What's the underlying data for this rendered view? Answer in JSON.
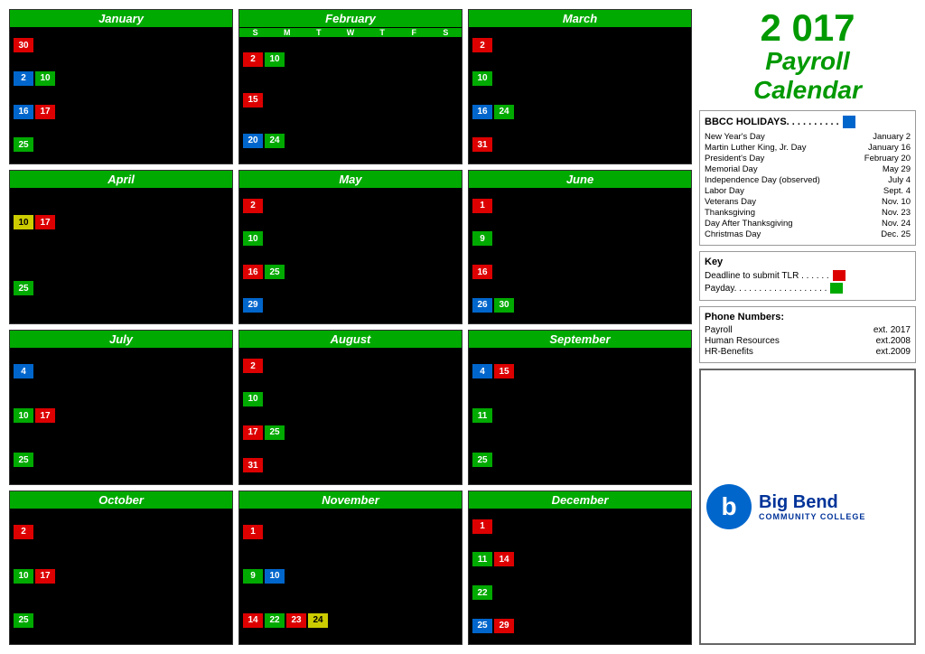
{
  "title": {
    "year": "2 017",
    "line1": "Payroll",
    "line2": "Calendar"
  },
  "months": [
    {
      "name": "January",
      "has_dow": false,
      "rows": [
        [
          {
            "num": "30",
            "color": "red",
            "col": "right"
          }
        ],
        [
          {
            "num": "2",
            "color": "blue",
            "col": "left"
          },
          {
            "num": "10",
            "color": "green",
            "col": "mid"
          }
        ],
        [
          {
            "num": "16",
            "color": "blue",
            "col": "left"
          },
          {
            "num": "17",
            "color": "red",
            "col": "mid"
          }
        ],
        [
          {
            "num": "25",
            "color": "green",
            "col": "mid"
          }
        ]
      ]
    },
    {
      "name": "February",
      "has_dow": true,
      "dow": [
        "S",
        "M",
        "T",
        "W",
        "T",
        "F",
        "S"
      ],
      "rows": [
        [
          {
            "num": "2",
            "color": "red",
            "col": "right"
          },
          {
            "num": "10",
            "color": "green",
            "col": "far-right"
          }
        ],
        [
          {
            "num": "15",
            "color": "red",
            "col": "mid"
          }
        ],
        [
          {
            "num": "20",
            "color": "blue",
            "col": "left"
          },
          {
            "num": "24",
            "color": "green",
            "col": "mid"
          }
        ]
      ]
    },
    {
      "name": "March",
      "has_dow": false,
      "rows": [
        [
          {
            "num": "2",
            "color": "red",
            "col": "right"
          }
        ],
        [
          {
            "num": "10",
            "color": "green",
            "col": "mid"
          }
        ],
        [
          {
            "num": "16",
            "color": "blue",
            "col": "left"
          },
          {
            "num": "24",
            "color": "green",
            "col": "mid"
          }
        ],
        [
          {
            "num": "31",
            "color": "red",
            "col": "mid"
          }
        ]
      ]
    },
    {
      "name": "April",
      "has_dow": false,
      "rows": [
        [
          {
            "num": "10",
            "color": "yellow",
            "col": "left"
          },
          {
            "num": "17",
            "color": "red",
            "col": "left2"
          }
        ],
        [
          {
            "num": "25",
            "color": "green",
            "col": "mid"
          }
        ]
      ]
    },
    {
      "name": "May",
      "has_dow": false,
      "rows": [
        [
          {
            "num": "2",
            "color": "red",
            "col": "right"
          }
        ],
        [
          {
            "num": "10",
            "color": "green",
            "col": "mid"
          }
        ],
        [
          {
            "num": "16",
            "color": "red",
            "col": "mid"
          },
          {
            "num": "25",
            "color": "green",
            "col": "far"
          }
        ],
        [
          {
            "num": "29",
            "color": "blue",
            "col": "left"
          }
        ]
      ]
    },
    {
      "name": "June",
      "has_dow": false,
      "rows": [
        [
          {
            "num": "1",
            "color": "red",
            "col": "right"
          }
        ],
        [
          {
            "num": "9",
            "color": "green",
            "col": "right"
          }
        ],
        [
          {
            "num": "16",
            "color": "red",
            "col": "right"
          }
        ],
        [
          {
            "num": "26",
            "color": "blue",
            "col": "left"
          },
          {
            "num": "30",
            "color": "green",
            "col": "mid"
          }
        ]
      ]
    },
    {
      "name": "July",
      "has_dow": false,
      "rows": [
        [
          {
            "num": "4",
            "color": "blue",
            "col": "right"
          }
        ],
        [
          {
            "num": "10",
            "color": "green",
            "col": "left"
          },
          {
            "num": "17",
            "color": "red",
            "col": "left2"
          }
        ],
        [
          {
            "num": "25",
            "color": "green",
            "col": "mid"
          }
        ]
      ]
    },
    {
      "name": "August",
      "has_dow": false,
      "rows": [
        [
          {
            "num": "2",
            "color": "red",
            "col": "right"
          }
        ],
        [
          {
            "num": "10",
            "color": "green",
            "col": "mid"
          }
        ],
        [
          {
            "num": "17",
            "color": "red",
            "col": "mid"
          },
          {
            "num": "25",
            "color": "green",
            "col": "far"
          }
        ],
        [
          {
            "num": "31",
            "color": "red",
            "col": "left"
          }
        ]
      ]
    },
    {
      "name": "September",
      "has_dow": false,
      "rows": [
        [
          {
            "num": "4",
            "color": "blue",
            "col": "left"
          },
          {
            "num": "15",
            "color": "red",
            "col": "right"
          }
        ],
        [
          {
            "num": "11",
            "color": "green",
            "col": "left"
          }
        ],
        [
          {
            "num": "25",
            "color": "green",
            "col": "left"
          }
        ]
      ]
    },
    {
      "name": "October",
      "has_dow": false,
      "rows": [
        [
          {
            "num": "2",
            "color": "red",
            "col": "left"
          }
        ],
        [
          {
            "num": "10",
            "color": "green",
            "col": "left"
          },
          {
            "num": "17",
            "color": "red",
            "col": "left2"
          }
        ],
        [
          {
            "num": "25",
            "color": "green",
            "col": "mid"
          }
        ]
      ]
    },
    {
      "name": "November",
      "has_dow": false,
      "rows": [
        [
          {
            "num": "1",
            "color": "red",
            "col": "mid"
          }
        ],
        [
          {
            "num": "9",
            "color": "green",
            "col": "left"
          },
          {
            "num": "10",
            "color": "blue",
            "col": "left2"
          }
        ],
        [
          {
            "num": "14",
            "color": "red",
            "col": "left"
          },
          {
            "num": "22",
            "color": "green",
            "col": "mid"
          },
          {
            "num": "23",
            "color": "red",
            "col": "far"
          },
          {
            "num": "24",
            "color": "yellow",
            "col": "far2"
          }
        ]
      ]
    },
    {
      "name": "December",
      "has_dow": false,
      "rows": [
        [
          {
            "num": "1",
            "color": "red",
            "col": "right"
          }
        ],
        [
          {
            "num": "11",
            "color": "green",
            "col": "left"
          },
          {
            "num": "14",
            "color": "red",
            "col": "mid"
          }
        ],
        [
          {
            "num": "22",
            "color": "green",
            "col": "right"
          }
        ],
        [
          {
            "num": "25",
            "color": "blue",
            "col": "left"
          },
          {
            "num": "29",
            "color": "red",
            "col": "right"
          }
        ]
      ]
    }
  ],
  "holidays": {
    "title": "BBCC HOLIDAYS. . . . . . . . . .",
    "items": [
      {
        "name": "New Year's Day",
        "date": "January 2"
      },
      {
        "name": "Martin Luther King, Jr. Day",
        "date": "January 16"
      },
      {
        "name": "President's Day",
        "date": "February 20"
      },
      {
        "name": "Memorial Day",
        "date": "May 29"
      },
      {
        "name": "Independence Day (observed)",
        "date": "July 4"
      },
      {
        "name": "Labor Day",
        "date": "Sept. 4"
      },
      {
        "name": "Veterans Day",
        "date": "Nov. 10"
      },
      {
        "name": "Thanksgiving",
        "date": "Nov. 23"
      },
      {
        "name": "Day After Thanksgiving",
        "date": "Nov. 24"
      },
      {
        "name": "Christmas Day",
        "date": "Dec. 25"
      }
    ]
  },
  "key": {
    "title": "Key",
    "items": [
      {
        "label": "Deadline to submit TLR . . . . . .",
        "color": "red"
      },
      {
        "label": "Payday. . . . . . . . . . . . . . . . . . .",
        "color": "green"
      }
    ]
  },
  "phone": {
    "title": "Phone Numbers:",
    "items": [
      {
        "dept": "Payroll",
        "ext": "ext. 2017"
      },
      {
        "dept": "Human Resources",
        "ext": "ext.2008"
      },
      {
        "dept": "HR-Benefits",
        "ext": "ext.2009"
      }
    ]
  },
  "logo": {
    "letter": "b",
    "name": "Big Bend",
    "sub": "COMMUNITY COLLEGE"
  }
}
